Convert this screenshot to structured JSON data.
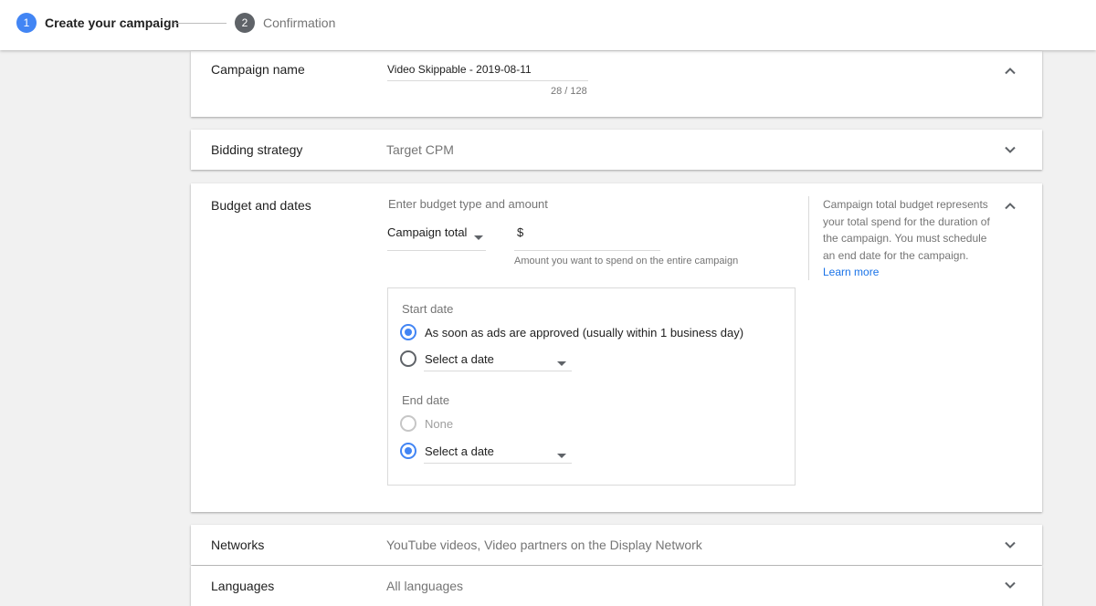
{
  "stepper": {
    "steps": [
      {
        "number": "1",
        "label": "Create your campaign",
        "active": true
      },
      {
        "number": "2",
        "label": "Confirmation",
        "active": false
      }
    ]
  },
  "campaign_name": {
    "label": "Campaign name",
    "value": "Video Skippable - 2019-08-11",
    "counter": "28 / 128",
    "expanded": true
  },
  "bidding": {
    "label": "Bidding strategy",
    "summary": "Target CPM",
    "expanded": false
  },
  "budget": {
    "label": "Budget and dates",
    "heading": "Enter budget type and amount",
    "budget_type": "Campaign total",
    "currency": "$",
    "amount": "",
    "amount_help": "Amount you want to spend on the entire campaign",
    "help_text": "Campaign total budget represents your total spend for the duration of the campaign. You must schedule an end date for the campaign.",
    "help_link": "Learn more",
    "expanded": true,
    "start_date": {
      "heading": "Start date",
      "option_asap": "As soon as ads are approved (usually within 1 business day)",
      "option_select": "Select a date",
      "selected": "asap"
    },
    "end_date": {
      "heading": "End date",
      "option_none": "None",
      "option_select": "Select a date",
      "selected": "select"
    }
  },
  "networks": {
    "label": "Networks",
    "summary": "YouTube videos, Video partners on the Display Network",
    "expanded": false
  },
  "languages": {
    "label": "Languages",
    "summary": "All languages",
    "expanded": false
  },
  "colors": {
    "accent": "#4285f4",
    "link": "#1a73e8",
    "inactive_step": "#5f6368"
  },
  "icons": {
    "expand": "chevron-down-icon",
    "collapse": "chevron-up-icon",
    "dropdown": "caret-down-icon"
  }
}
